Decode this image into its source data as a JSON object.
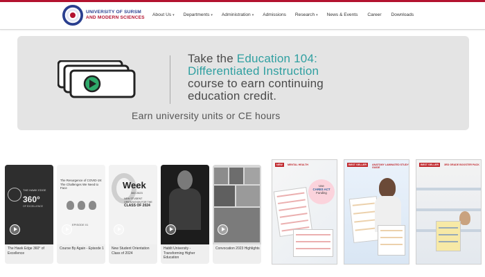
{
  "header": {
    "logo_line1": "UNIVERSITY OF SURSM",
    "logo_line2": "AND MODERN SCIENCES",
    "nav": [
      {
        "label": "About Us",
        "dropdown": true
      },
      {
        "label": "Departments",
        "dropdown": true
      },
      {
        "label": "Administration",
        "dropdown": true
      },
      {
        "label": "Admissions",
        "dropdown": false
      },
      {
        "label": "Research",
        "dropdown": true
      },
      {
        "label": "News & Events",
        "dropdown": false
      },
      {
        "label": "Career",
        "dropdown": false
      },
      {
        "label": "Downloads",
        "dropdown": false
      }
    ]
  },
  "banner": {
    "line1_prefix": "Take the ",
    "line1_accent": "Education 104:",
    "line2_accent": "Differentiated Instruction",
    "line3": "course to earn continuing",
    "line4": "education credit.",
    "subline": "Earn university units or CE hours"
  },
  "videos": [
    {
      "title": "The Hawk Edge 360° of Excellence",
      "thumb_heading": "THE HAWK EDGE",
      "thumb_big": "360°",
      "thumb_small": "OF EXCELLENCE"
    },
    {
      "title": "Course By Again - Episode 1",
      "thumb_heading": "The Resurgence of COVID-19: The Challenges We Need to Face",
      "thumb_episode": "EPISODE 01"
    },
    {
      "title": "New Student Orientation Class of 2024",
      "thumb_big": "Week",
      "thumb_year": "360 2023",
      "thumb_sub": "NEW STUDENT ORIENTATION FOR THE",
      "thumb_class": "CLASS OF 2024"
    },
    {
      "title": "Hablit University - Transforming Higher Education"
    },
    {
      "title": "Convocation 2023 Highlights"
    }
  ],
  "books": [
    {
      "badge": "NEW",
      "title": "MENTAL HEALTH",
      "promo_line1": "Use",
      "promo_line2": "CARES ACT",
      "promo_line3": "Funding"
    },
    {
      "badge": "BEST SELLER",
      "title": "ANATOMY LAMINATED STUDY GUIDE"
    },
    {
      "badge": "BEST SELLER",
      "title": "3RD GRADE BOOSTER PACK"
    }
  ],
  "colors": {
    "brand_red": "#b3122f",
    "brand_blue": "#2a3f8f",
    "banner_accent": "#2f9fa0",
    "banner_bg": "#e4e4e4"
  }
}
